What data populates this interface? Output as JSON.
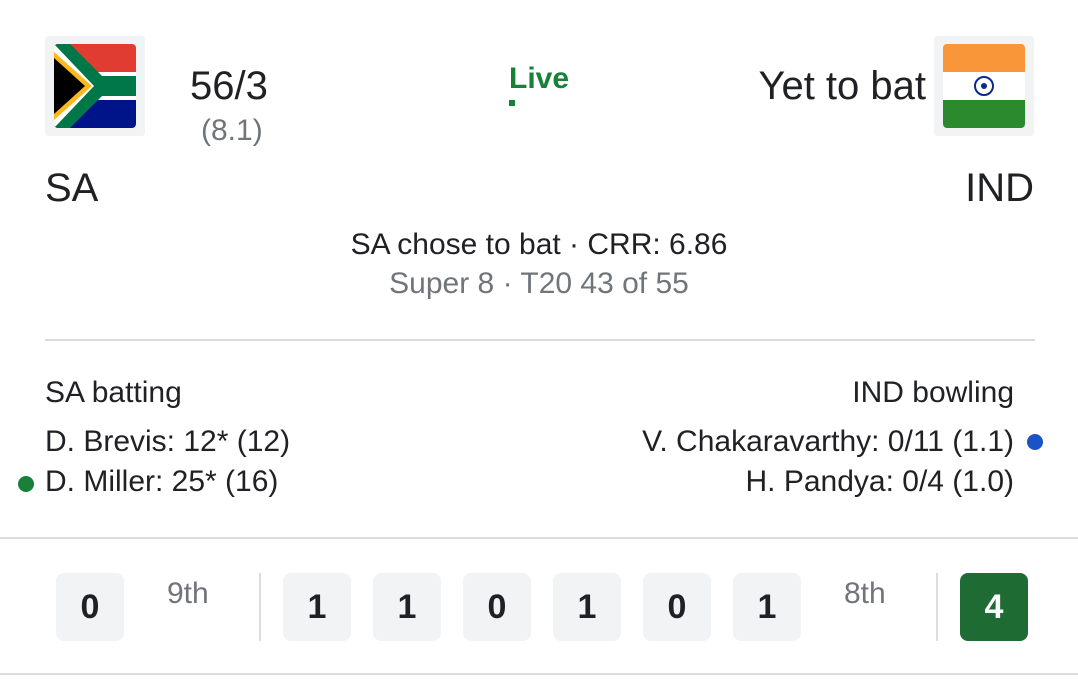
{
  "home": {
    "team": "SA",
    "flag_icon": "south-africa-flag-icon",
    "score": "56/3",
    "overs": "(8.1)"
  },
  "away": {
    "team": "IND",
    "flag_icon": "india-flag-icon",
    "status": "Yet to bat"
  },
  "status": {
    "label": "Live",
    "color": "#188038"
  },
  "match_info": {
    "line1": "SA chose to bat · CRR: 6.86",
    "line2": "Super 8 · T20 43 of 55"
  },
  "batting": {
    "title": "SA batting",
    "players": [
      {
        "text": "D. Brevis: 12* (12)",
        "on_strike": false
      },
      {
        "text": "D. Miller: 25* (16)",
        "on_strike": true
      }
    ],
    "indicator_color": "#188038"
  },
  "bowling": {
    "title": "IND bowling",
    "players": [
      {
        "text": "V. Chakaravarthy: 0/11 (1.1)",
        "current": true
      },
      {
        "text": "H. Pandya: 0/4 (1.0)",
        "current": false
      }
    ],
    "indicator_color": "#1a53c5"
  },
  "recent_balls": {
    "over_9": {
      "label": "9th",
      "balls": [
        "0"
      ]
    },
    "over_8": {
      "label": "8th",
      "balls": [
        "1",
        "1",
        "0",
        "1",
        "0",
        "1"
      ]
    },
    "previous": {
      "balls": [
        "4"
      ],
      "boundary_color": "#1e6b34"
    }
  }
}
